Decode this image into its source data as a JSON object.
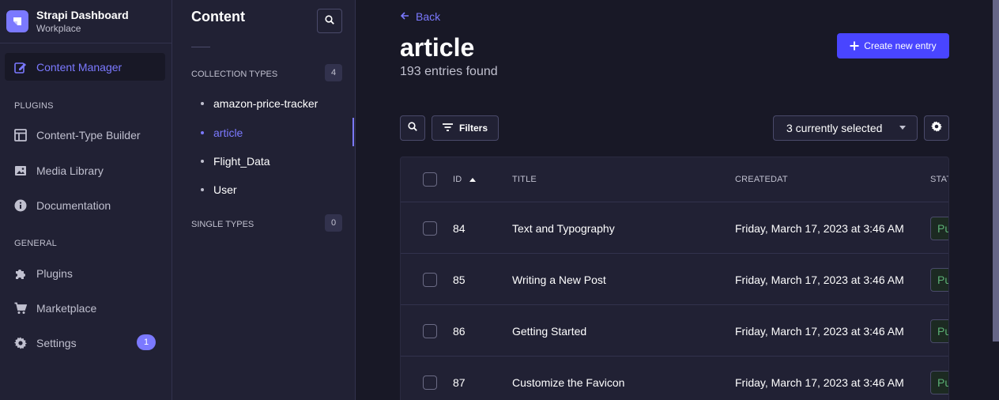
{
  "brand": {
    "title": "Strapi Dashboard",
    "subtitle": "Workplace"
  },
  "mainnav": {
    "content_manager": "Content Manager",
    "plugins_section": "PLUGINS",
    "content_type_builder": "Content-Type Builder",
    "media_library": "Media Library",
    "documentation": "Documentation",
    "general_section": "GENERAL",
    "plugins": "Plugins",
    "marketplace": "Marketplace",
    "settings": "Settings",
    "settings_badge": "1"
  },
  "subnav": {
    "title": "Content",
    "collection_types": "COLLECTION TYPES",
    "collection_count": "4",
    "items": [
      "amazon-price-tracker",
      "article",
      "Flight_Data",
      "User"
    ],
    "single_types": "SINGLE TYPES",
    "single_count": "0"
  },
  "main": {
    "back": "Back",
    "title": "article",
    "subtitle": "193 entries found",
    "create_label": "Create new entry",
    "filters_label": "Filters",
    "columns_selected": "3 currently selected"
  },
  "table": {
    "headers": {
      "id": "ID",
      "title": "TITLE",
      "createdat": "CREATEDAT",
      "status": "STATE"
    },
    "rows": [
      {
        "id": "84",
        "title": "Text and Typography",
        "created": "Friday, March 17, 2023 at 3:46 AM",
        "status": "Pu"
      },
      {
        "id": "85",
        "title": "Writing a New Post",
        "created": "Friday, March 17, 2023 at 3:46 AM",
        "status": "Pu"
      },
      {
        "id": "86",
        "title": "Getting Started",
        "created": "Friday, March 17, 2023 at 3:46 AM",
        "status": "Pu"
      },
      {
        "id": "87",
        "title": "Customize the Favicon",
        "created": "Friday, March 17, 2023 at 3:46 AM",
        "status": "Pu"
      }
    ]
  },
  "colors": {
    "accent": "#7b79ff",
    "primary": "#4945ff",
    "bg": "#181826",
    "panel": "#212134",
    "success": "#5cb176"
  }
}
